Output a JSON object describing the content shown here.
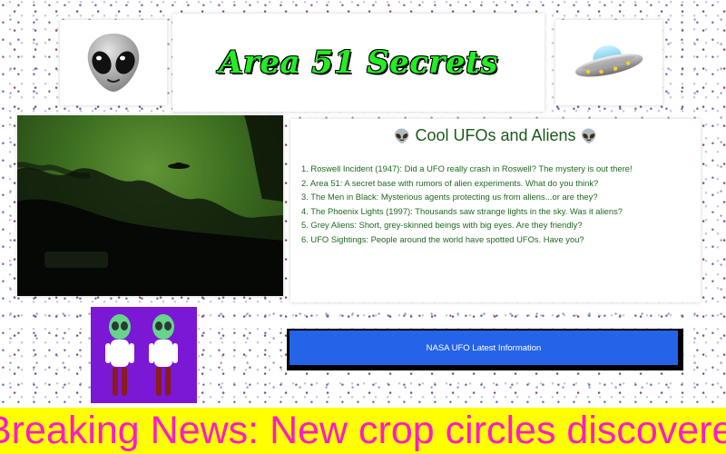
{
  "header": {
    "title": "Area 51 Secrets",
    "left_icon": "alien-face-icon",
    "right_icon": "flying-saucer-icon"
  },
  "hero_image": {
    "subject": "ufo-over-palm-trees-photo"
  },
  "info": {
    "heading": "Cool UFOs and Aliens",
    "heading_icon": "alien-face-icon",
    "facts": [
      "1. Roswell Incident (1947): Did a UFO really crash in Roswell? The mystery is out there!",
      "2. Area 51: A secret base with rumors of alien experiments. What do you think?",
      "3. The Men in Black: Mysterious agents protecting us from aliens...or are they?",
      "4. The Phoenix Lights (1997): Thousands saw strange lights in the sky. Was it aliens?",
      "5. Grey Aliens: Short, grey-skinned beings with big eyes. Are they friendly?",
      "6. UFO Sightings: People around the world have spotted UFOs. Have you?"
    ]
  },
  "side_image": {
    "subject": "two-green-aliens-illustration"
  },
  "nasa_button": {
    "label": "NASA UFO Latest Information"
  },
  "ticker": {
    "text": "Breaking News: New crop circles discovered!"
  },
  "colors": {
    "title_green": "#22ee22",
    "heading_green": "#1a5a1a",
    "facts_green": "#1f6a1f",
    "button_blue": "#2563e8",
    "ticker_yellow": "#ffff00",
    "ticker_text_magenta": "#ff1acc",
    "alien_panel_purple": "#7a18d6"
  }
}
